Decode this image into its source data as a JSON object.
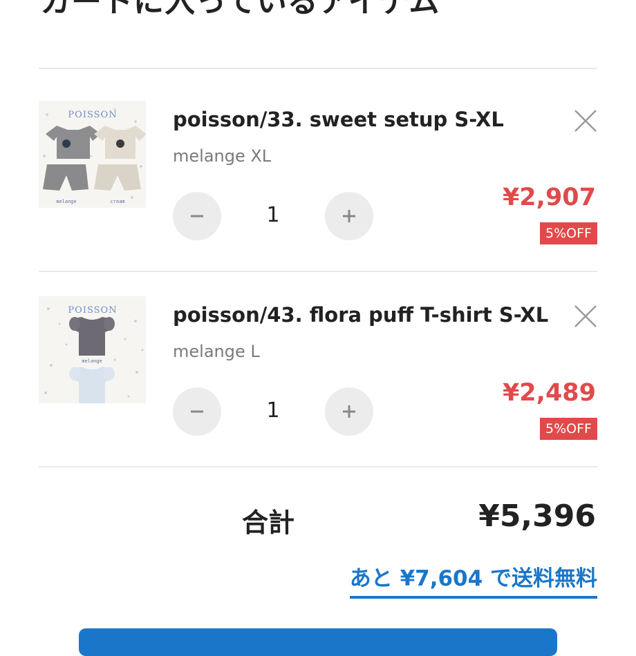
{
  "page": {
    "title": "カートに入っているアイテム"
  },
  "cart": {
    "items": [
      {
        "name": "poisson/33. sweet setup S-XL",
        "variant": "melange XL",
        "quantity": "1",
        "price": "¥2,907",
        "discount": "5%OFF",
        "image": {
          "brand": "POISSON",
          "labels": [
            "melange",
            "cream"
          ]
        }
      },
      {
        "name": "poisson/43. flora puff T-shirt S-XL",
        "variant": "melange L",
        "quantity": "1",
        "price": "¥2,489",
        "discount": "5%OFF",
        "image": {
          "brand": "POISSON",
          "labels": [
            "melange"
          ]
        }
      }
    ]
  },
  "summary": {
    "total_label": "合計",
    "total_value": "¥5,396",
    "free_shipping_text": "あと ¥7,604 で送料無料"
  },
  "icons": {
    "remove": "close-icon",
    "decrease": "minus-icon",
    "increase": "plus-icon"
  },
  "colors": {
    "price_red": "#e14a4a",
    "link_blue": "#1a76c9",
    "qty_button_gray": "#ececec",
    "divider": "#e9e9e9"
  }
}
